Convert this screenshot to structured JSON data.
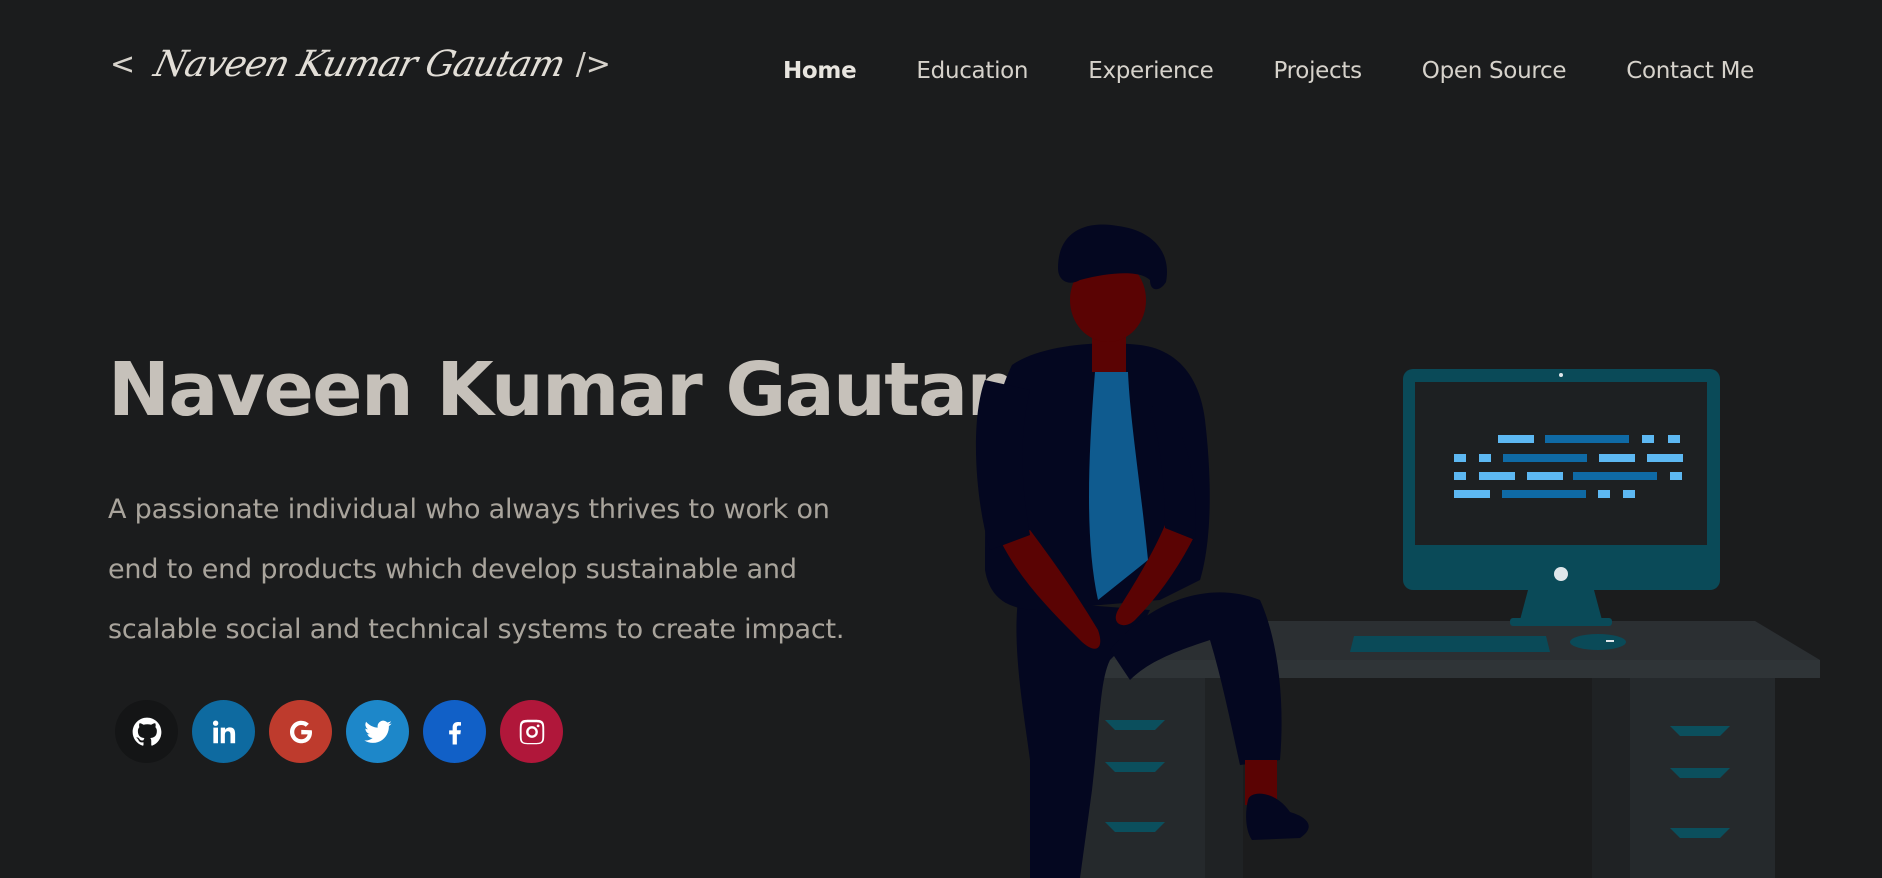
{
  "logo": {
    "open": "<",
    "signature": "Naveen Kumar Gautam",
    "close": "/>"
  },
  "nav": {
    "items": [
      {
        "label": "Home",
        "active": true
      },
      {
        "label": "Education"
      },
      {
        "label": "Experience"
      },
      {
        "label": "Projects"
      },
      {
        "label": "Open Source"
      },
      {
        "label": "Contact Me"
      }
    ]
  },
  "hero": {
    "title": "Naveen Kumar Gautam",
    "subtitle_line1": "A passionate individual who always thrives to work on",
    "subtitle_line2": "end to end products which develop sustainable and",
    "subtitle_line3": "scalable social and technical systems to create impact."
  },
  "socials": [
    {
      "name": "github-icon",
      "color": "#141516"
    },
    {
      "name": "linkedin-icon",
      "color": "#0e6aa0"
    },
    {
      "name": "google-icon",
      "color": "#be3b2d"
    },
    {
      "name": "twitter-icon",
      "color": "#1d87c9"
    },
    {
      "name": "facebook-icon",
      "color": "#1160c7"
    },
    {
      "name": "instagram-icon",
      "color": "#b0173a"
    }
  ],
  "colors": {
    "background": "#1b1c1d",
    "text_primary": "#c6c1ba",
    "text_secondary": "#a9a49c",
    "monitor": "#0a4a58",
    "code_accent": "#5db8f2"
  }
}
